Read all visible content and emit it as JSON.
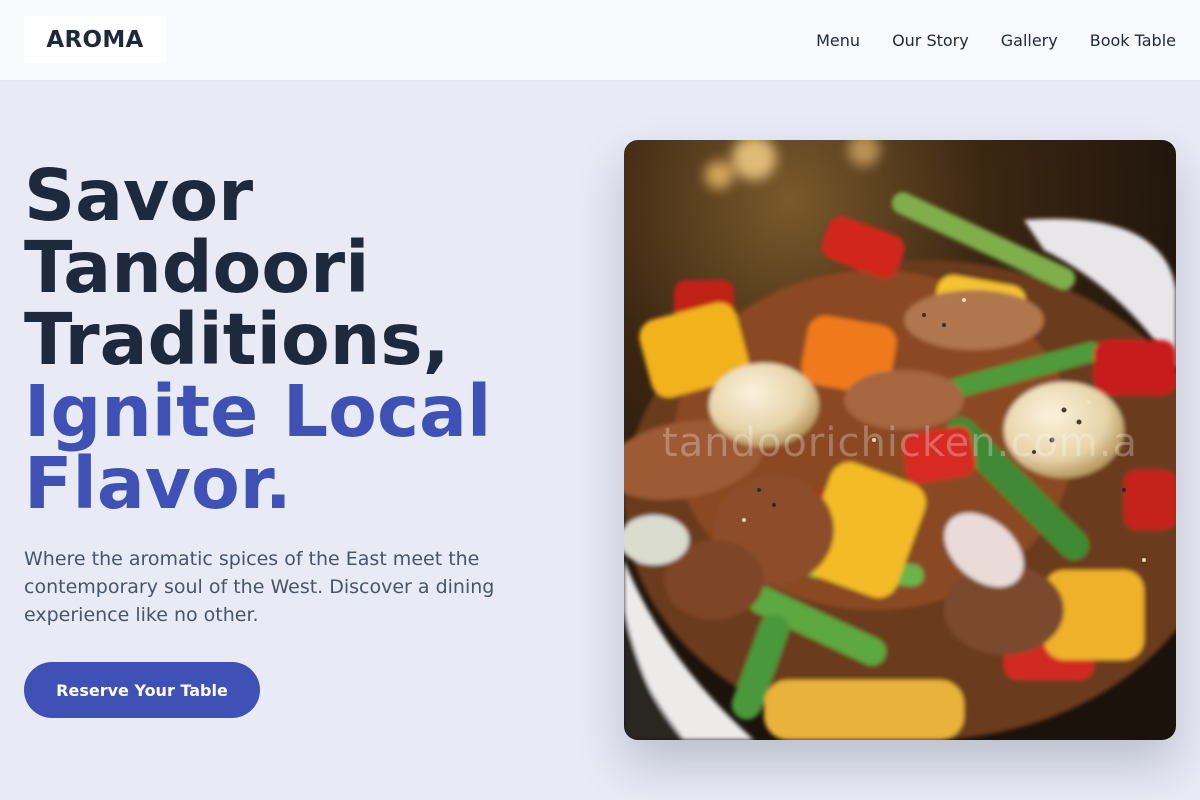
{
  "brand": {
    "logo_text": "AROMA"
  },
  "nav": {
    "items": [
      {
        "label": "Menu"
      },
      {
        "label": "Our Story"
      },
      {
        "label": "Gallery"
      },
      {
        "label": "Book Table"
      }
    ]
  },
  "hero": {
    "title_lines": [
      "Savor",
      "Tandoori",
      "Traditions,"
    ],
    "title_accent_lines": [
      "Ignite Local",
      "Flavor."
    ],
    "subtitle": "Where the aromatic spices of the East meet the contemporary soul of the West. Discover a dining experience like no other.",
    "cta_label": "Reserve Your Table",
    "image_watermark": "tandoorichicken.com.a"
  },
  "colors": {
    "accent": "#3f51b5",
    "heading": "#1e293b",
    "body_text": "#475569",
    "page_background": "#e8eaf6",
    "header_background": "#f8f9fc"
  }
}
